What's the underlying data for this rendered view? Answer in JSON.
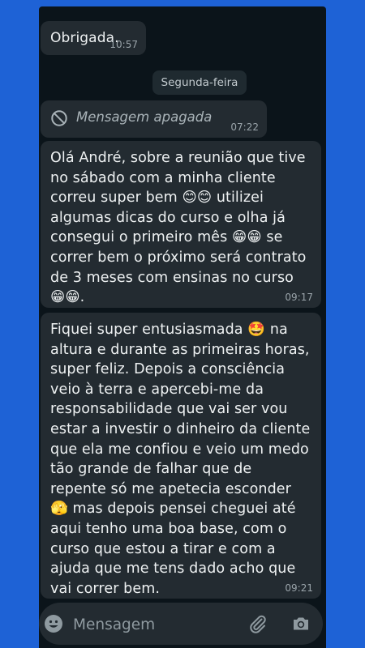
{
  "messages": [
    {
      "text": "Obrigada.",
      "time": "10:57"
    },
    {
      "deleted_text": "Mensagem apagada",
      "time": "07:22"
    },
    {
      "text": "Olá André, sobre a reunião que tive no sábado com a minha cliente correu super bem 😊😊 utilizei algumas dicas do curso e olha já consegui o primeiro mês 😁😁 se correr bem o próximo será contrato de 3 meses com ensinas no curso 😁😁.",
      "time": "09:17"
    },
    {
      "text": "Fiquei super entusiasmada 🤩 na altura e durante as primeiras horas, super feliz. Depois a consciência veio à terra e apercebi-me da responsabilidade que vai ser vou estar a investir o dinheiro da cliente que ela me confiou e veio um medo tão grande de falhar que de repente só me apetecia esconder 🫣 mas depois pensei cheguei até aqui tenho uma boa base, com o curso que estou a tirar e com a ajuda que me tens dado acho que vai correr bem.",
      "time": "09:21"
    }
  ],
  "date_divider": "Segunda-feira",
  "composer": {
    "placeholder": "Mensagem"
  },
  "icons": {
    "emoji": "emoji-icon",
    "attach": "paperclip-icon",
    "camera": "camera-icon",
    "deleted": "block-icon"
  },
  "colors": {
    "background": "#1e62d6",
    "chat": "#0b141a",
    "bubble": "#232b31"
  }
}
